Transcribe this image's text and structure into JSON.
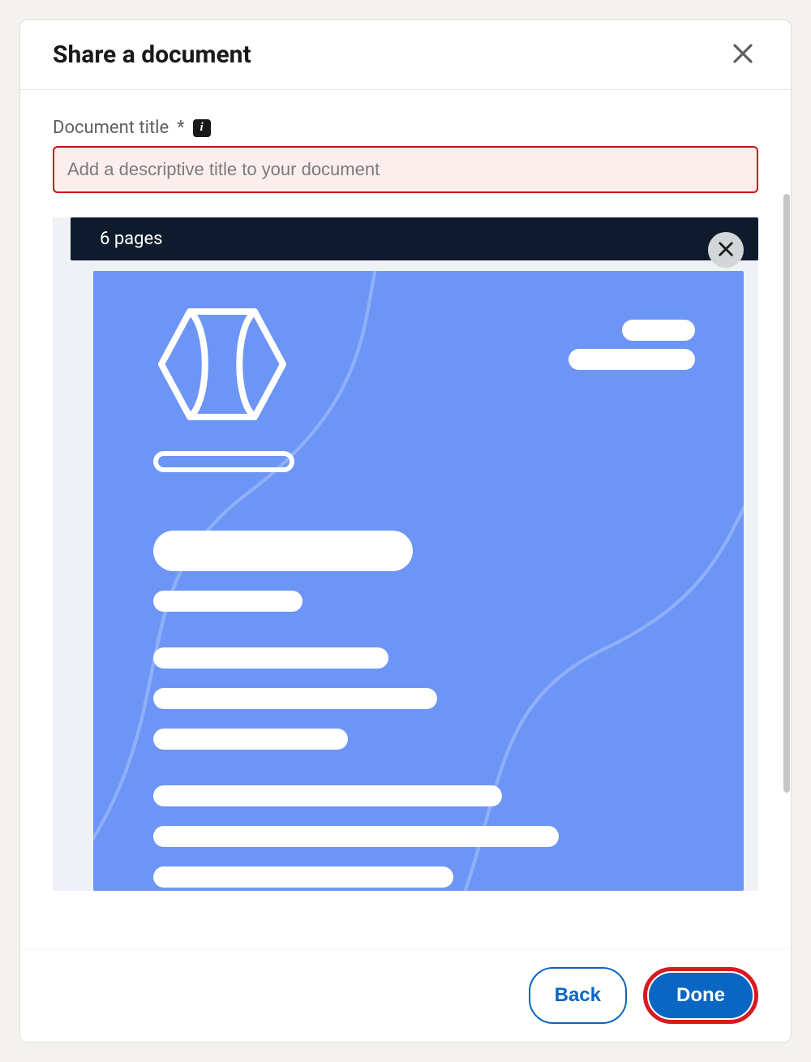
{
  "header": {
    "title": "Share a document"
  },
  "form": {
    "title_label": "Document title",
    "required_marker": "*",
    "title_placeholder": "Add a descriptive title to your document",
    "title_value": ""
  },
  "preview": {
    "page_count_label": "6 pages"
  },
  "footer": {
    "back_label": "Back",
    "done_label": "Done"
  },
  "icons": {
    "info": "i"
  }
}
